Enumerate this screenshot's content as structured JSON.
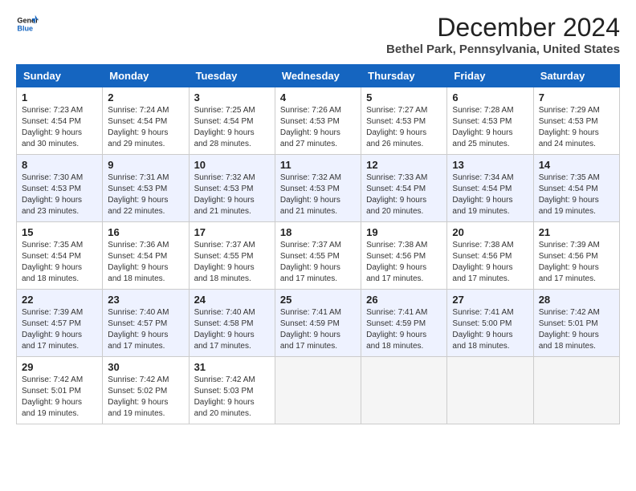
{
  "logo": {
    "line1": "General",
    "line2": "Blue"
  },
  "title": "December 2024",
  "location": "Bethel Park, Pennsylvania, United States",
  "days_of_week": [
    "Sunday",
    "Monday",
    "Tuesday",
    "Wednesday",
    "Thursday",
    "Friday",
    "Saturday"
  ],
  "weeks": [
    [
      {
        "day": "1",
        "sunrise": "7:23 AM",
        "sunset": "4:54 PM",
        "daylight": "9 hours and 30 minutes."
      },
      {
        "day": "2",
        "sunrise": "7:24 AM",
        "sunset": "4:54 PM",
        "daylight": "9 hours and 29 minutes."
      },
      {
        "day": "3",
        "sunrise": "7:25 AM",
        "sunset": "4:54 PM",
        "daylight": "9 hours and 28 minutes."
      },
      {
        "day": "4",
        "sunrise": "7:26 AM",
        "sunset": "4:53 PM",
        "daylight": "9 hours and 27 minutes."
      },
      {
        "day": "5",
        "sunrise": "7:27 AM",
        "sunset": "4:53 PM",
        "daylight": "9 hours and 26 minutes."
      },
      {
        "day": "6",
        "sunrise": "7:28 AM",
        "sunset": "4:53 PM",
        "daylight": "9 hours and 25 minutes."
      },
      {
        "day": "7",
        "sunrise": "7:29 AM",
        "sunset": "4:53 PM",
        "daylight": "9 hours and 24 minutes."
      }
    ],
    [
      {
        "day": "8",
        "sunrise": "7:30 AM",
        "sunset": "4:53 PM",
        "daylight": "9 hours and 23 minutes."
      },
      {
        "day": "9",
        "sunrise": "7:31 AM",
        "sunset": "4:53 PM",
        "daylight": "9 hours and 22 minutes."
      },
      {
        "day": "10",
        "sunrise": "7:32 AM",
        "sunset": "4:53 PM",
        "daylight": "9 hours and 21 minutes."
      },
      {
        "day": "11",
        "sunrise": "7:32 AM",
        "sunset": "4:53 PM",
        "daylight": "9 hours and 21 minutes."
      },
      {
        "day": "12",
        "sunrise": "7:33 AM",
        "sunset": "4:54 PM",
        "daylight": "9 hours and 20 minutes."
      },
      {
        "day": "13",
        "sunrise": "7:34 AM",
        "sunset": "4:54 PM",
        "daylight": "9 hours and 19 minutes."
      },
      {
        "day": "14",
        "sunrise": "7:35 AM",
        "sunset": "4:54 PM",
        "daylight": "9 hours and 19 minutes."
      }
    ],
    [
      {
        "day": "15",
        "sunrise": "7:35 AM",
        "sunset": "4:54 PM",
        "daylight": "9 hours and 18 minutes."
      },
      {
        "day": "16",
        "sunrise": "7:36 AM",
        "sunset": "4:54 PM",
        "daylight": "9 hours and 18 minutes."
      },
      {
        "day": "17",
        "sunrise": "7:37 AM",
        "sunset": "4:55 PM",
        "daylight": "9 hours and 18 minutes."
      },
      {
        "day": "18",
        "sunrise": "7:37 AM",
        "sunset": "4:55 PM",
        "daylight": "9 hours and 17 minutes."
      },
      {
        "day": "19",
        "sunrise": "7:38 AM",
        "sunset": "4:56 PM",
        "daylight": "9 hours and 17 minutes."
      },
      {
        "day": "20",
        "sunrise": "7:38 AM",
        "sunset": "4:56 PM",
        "daylight": "9 hours and 17 minutes."
      },
      {
        "day": "21",
        "sunrise": "7:39 AM",
        "sunset": "4:56 PM",
        "daylight": "9 hours and 17 minutes."
      }
    ],
    [
      {
        "day": "22",
        "sunrise": "7:39 AM",
        "sunset": "4:57 PM",
        "daylight": "9 hours and 17 minutes."
      },
      {
        "day": "23",
        "sunrise": "7:40 AM",
        "sunset": "4:57 PM",
        "daylight": "9 hours and 17 minutes."
      },
      {
        "day": "24",
        "sunrise": "7:40 AM",
        "sunset": "4:58 PM",
        "daylight": "9 hours and 17 minutes."
      },
      {
        "day": "25",
        "sunrise": "7:41 AM",
        "sunset": "4:59 PM",
        "daylight": "9 hours and 17 minutes."
      },
      {
        "day": "26",
        "sunrise": "7:41 AM",
        "sunset": "4:59 PM",
        "daylight": "9 hours and 18 minutes."
      },
      {
        "day": "27",
        "sunrise": "7:41 AM",
        "sunset": "5:00 PM",
        "daylight": "9 hours and 18 minutes."
      },
      {
        "day": "28",
        "sunrise": "7:42 AM",
        "sunset": "5:01 PM",
        "daylight": "9 hours and 18 minutes."
      }
    ],
    [
      {
        "day": "29",
        "sunrise": "7:42 AM",
        "sunset": "5:01 PM",
        "daylight": "9 hours and 19 minutes."
      },
      {
        "day": "30",
        "sunrise": "7:42 AM",
        "sunset": "5:02 PM",
        "daylight": "9 hours and 19 minutes."
      },
      {
        "day": "31",
        "sunrise": "7:42 AM",
        "sunset": "5:03 PM",
        "daylight": "9 hours and 20 minutes."
      },
      null,
      null,
      null,
      null
    ]
  ],
  "labels": {
    "sunrise": "Sunrise:",
    "sunset": "Sunset:",
    "daylight": "Daylight:"
  }
}
